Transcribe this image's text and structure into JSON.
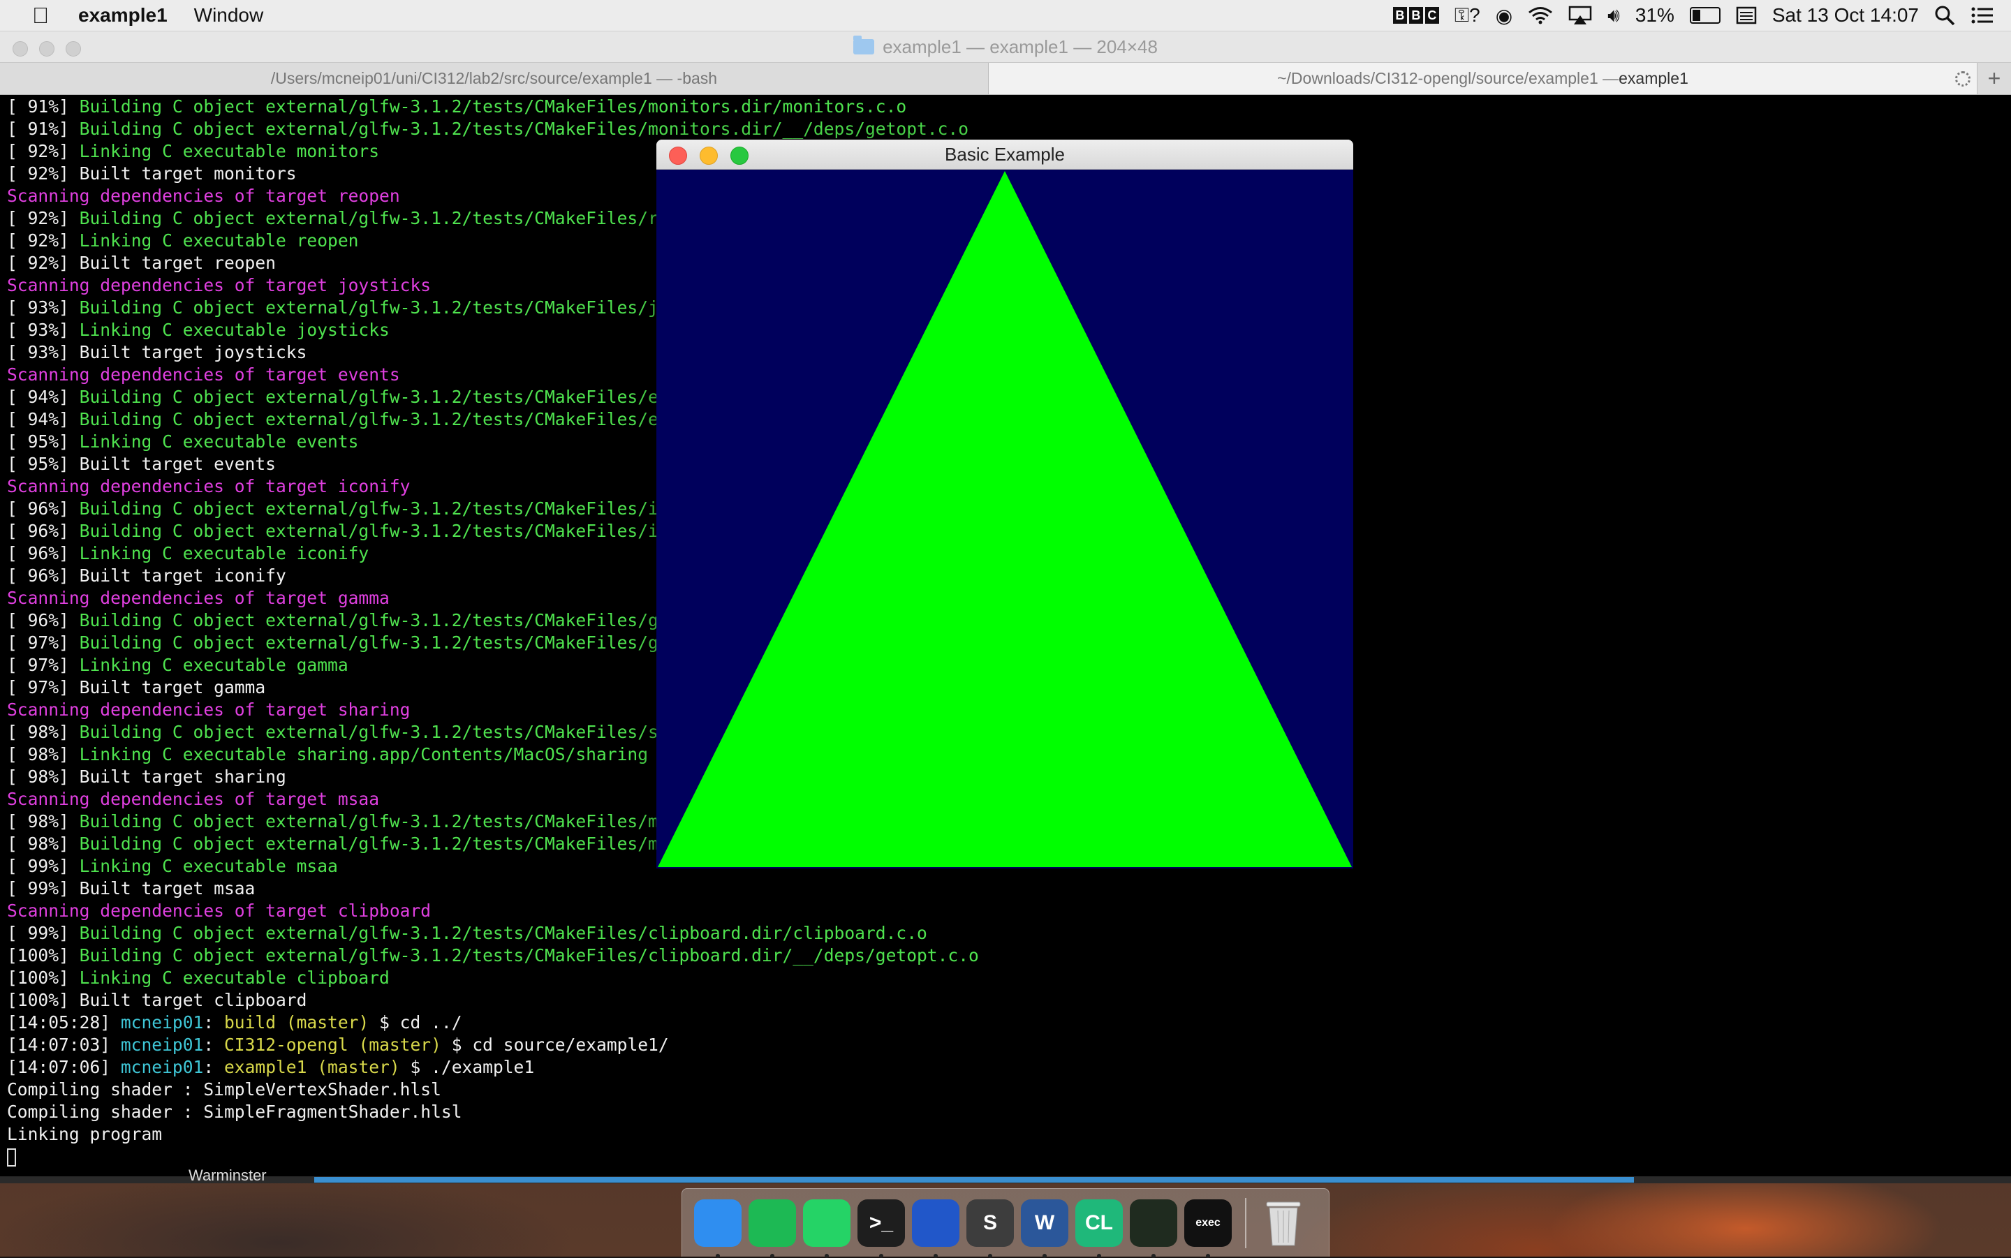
{
  "menubar": {
    "app_name": "example1",
    "menus": [
      "Window"
    ],
    "status": {
      "bbc": [
        "B",
        "B",
        "C"
      ],
      "battery_percent": "31%",
      "battery_level": 0.31,
      "datetime": "Sat 13 Oct  14:07"
    }
  },
  "terminal": {
    "title": "example1 — example1 — 204×48",
    "tabs": [
      {
        "label": "/Users/mcneip01/uni/CI312/lab2/src/source/example1 — -bash",
        "bold": ""
      },
      {
        "label": "~/Downloads/CI312-opengl/source/example1 — ",
        "bold": "example1"
      }
    ],
    "lines": [
      {
        "spans": [
          {
            "t": "[ 91%] ",
            "c": "w"
          },
          {
            "t": "Building C object external/glfw-3.1.2/tests/CMakeFiles/monitors.dir/monitors.c.o",
            "c": "g"
          }
        ]
      },
      {
        "spans": [
          {
            "t": "[ 91%] ",
            "c": "w"
          },
          {
            "t": "Building C object external/glfw-3.1.2/tests/CMakeFiles/monitors.dir/__/deps/getopt.c.o",
            "c": "g"
          }
        ]
      },
      {
        "spans": [
          {
            "t": "[ 92%] ",
            "c": "w"
          },
          {
            "t": "Linking C executable monitors",
            "c": "g"
          }
        ]
      },
      {
        "spans": [
          {
            "t": "[ 92%] Built target monitors",
            "c": "w"
          }
        ]
      },
      {
        "spans": [
          {
            "t": "Scanning dependencies of target reopen",
            "c": "m"
          }
        ]
      },
      {
        "spans": [
          {
            "t": "[ 92%] ",
            "c": "w"
          },
          {
            "t": "Building C object external/glfw-3.1.2/tests/CMakeFiles/reope",
            "c": "g"
          }
        ]
      },
      {
        "spans": [
          {
            "t": "[ 92%] ",
            "c": "w"
          },
          {
            "t": "Linking C executable reopen",
            "c": "g"
          }
        ]
      },
      {
        "spans": [
          {
            "t": "[ 92%] Built target reopen",
            "c": "w"
          }
        ]
      },
      {
        "spans": [
          {
            "t": "Scanning dependencies of target joysticks",
            "c": "m"
          }
        ]
      },
      {
        "spans": [
          {
            "t": "[ 93%] ",
            "c": "w"
          },
          {
            "t": "Building C object external/glfw-3.1.2/tests/CMakeFiles/joyst",
            "c": "g"
          }
        ]
      },
      {
        "spans": [
          {
            "t": "[ 93%] ",
            "c": "w"
          },
          {
            "t": "Linking C executable joysticks",
            "c": "g"
          }
        ]
      },
      {
        "spans": [
          {
            "t": "[ 93%] Built target joysticks",
            "c": "w"
          }
        ]
      },
      {
        "spans": [
          {
            "t": "Scanning dependencies of target events",
            "c": "m"
          }
        ]
      },
      {
        "spans": [
          {
            "t": "[ 94%] ",
            "c": "w"
          },
          {
            "t": "Building C object external/glfw-3.1.2/tests/CMakeFiles/event",
            "c": "g"
          }
        ]
      },
      {
        "spans": [
          {
            "t": "[ 94%] ",
            "c": "w"
          },
          {
            "t": "Building C object external/glfw-3.1.2/tests/CMakeFiles/event",
            "c": "g"
          }
        ]
      },
      {
        "spans": [
          {
            "t": "[ 95%] ",
            "c": "w"
          },
          {
            "t": "Linking C executable events",
            "c": "g"
          }
        ]
      },
      {
        "spans": [
          {
            "t": "[ 95%] Built target events",
            "c": "w"
          }
        ]
      },
      {
        "spans": [
          {
            "t": "Scanning dependencies of target iconify",
            "c": "m"
          }
        ]
      },
      {
        "spans": [
          {
            "t": "[ 96%] ",
            "c": "w"
          },
          {
            "t": "Building C object external/glfw-3.1.2/tests/CMakeFiles/iconi",
            "c": "g"
          }
        ]
      },
      {
        "spans": [
          {
            "t": "[ 96%] ",
            "c": "w"
          },
          {
            "t": "Building C object external/glfw-3.1.2/tests/CMakeFiles/iconi",
            "c": "g"
          }
        ]
      },
      {
        "spans": [
          {
            "t": "[ 96%] ",
            "c": "w"
          },
          {
            "t": "Linking C executable iconify",
            "c": "g"
          }
        ]
      },
      {
        "spans": [
          {
            "t": "[ 96%] Built target iconify",
            "c": "w"
          }
        ]
      },
      {
        "spans": [
          {
            "t": "Scanning dependencies of target gamma",
            "c": "m"
          }
        ]
      },
      {
        "spans": [
          {
            "t": "[ 96%] ",
            "c": "w"
          },
          {
            "t": "Building C object external/glfw-3.1.2/tests/CMakeFiles/gamma",
            "c": "g"
          }
        ]
      },
      {
        "spans": [
          {
            "t": "[ 97%] ",
            "c": "w"
          },
          {
            "t": "Building C object external/glfw-3.1.2/tests/CMakeFiles/gamma",
            "c": "g"
          }
        ]
      },
      {
        "spans": [
          {
            "t": "[ 97%] ",
            "c": "w"
          },
          {
            "t": "Linking C executable gamma",
            "c": "g"
          }
        ]
      },
      {
        "spans": [
          {
            "t": "[ 97%] Built target gamma",
            "c": "w"
          }
        ]
      },
      {
        "spans": [
          {
            "t": "Scanning dependencies of target sharing",
            "c": "m"
          }
        ]
      },
      {
        "spans": [
          {
            "t": "[ 98%] ",
            "c": "w"
          },
          {
            "t": "Building C object external/glfw-3.1.2/tests/CMakeFiles/shari",
            "c": "g"
          }
        ]
      },
      {
        "spans": [
          {
            "t": "[ 98%] ",
            "c": "w"
          },
          {
            "t": "Linking C executable sharing.app/Contents/MacOS/sharing",
            "c": "g"
          }
        ]
      },
      {
        "spans": [
          {
            "t": "[ 98%] Built target sharing",
            "c": "w"
          }
        ]
      },
      {
        "spans": [
          {
            "t": "Scanning dependencies of target msaa",
            "c": "m"
          }
        ]
      },
      {
        "spans": [
          {
            "t": "[ 98%] ",
            "c": "w"
          },
          {
            "t": "Building C object external/glfw-3.1.2/tests/CMakeFiles/msaa.",
            "c": "g"
          }
        ]
      },
      {
        "spans": [
          {
            "t": "[ 98%] ",
            "c": "w"
          },
          {
            "t": "Building C object external/glfw-3.1.2/tests/CMakeFiles/msaa.",
            "c": "g"
          }
        ]
      },
      {
        "spans": [
          {
            "t": "[ 99%] ",
            "c": "w"
          },
          {
            "t": "Linking C executable msaa",
            "c": "g"
          }
        ]
      },
      {
        "spans": [
          {
            "t": "[ 99%] Built target msaa",
            "c": "w"
          }
        ]
      },
      {
        "spans": [
          {
            "t": "Scanning dependencies of target clipboard",
            "c": "m"
          }
        ]
      },
      {
        "spans": [
          {
            "t": "[ 99%] ",
            "c": "w"
          },
          {
            "t": "Building C object external/glfw-3.1.2/tests/CMakeFiles/clipboard.dir/clipboard.c.o",
            "c": "g"
          }
        ]
      },
      {
        "spans": [
          {
            "t": "[100%] ",
            "c": "w"
          },
          {
            "t": "Building C object external/glfw-3.1.2/tests/CMakeFiles/clipboard.dir/__/deps/getopt.c.o",
            "c": "g"
          }
        ]
      },
      {
        "spans": [
          {
            "t": "[100%] ",
            "c": "w"
          },
          {
            "t": "Linking C executable clipboard",
            "c": "g"
          }
        ]
      },
      {
        "spans": [
          {
            "t": "[100%] Built target clipboard",
            "c": "w"
          }
        ]
      },
      {
        "spans": [
          {
            "t": "[14:05:28] ",
            "c": "w"
          },
          {
            "t": "mcneip01",
            "c": "c"
          },
          {
            "t": ": ",
            "c": "w"
          },
          {
            "t": "build (master)",
            "c": "y"
          },
          {
            "t": " $ cd ../",
            "c": "w"
          }
        ]
      },
      {
        "spans": [
          {
            "t": "[14:07:03] ",
            "c": "w"
          },
          {
            "t": "mcneip01",
            "c": "c"
          },
          {
            "t": ": ",
            "c": "w"
          },
          {
            "t": "CI312-opengl (master)",
            "c": "y"
          },
          {
            "t": " $ cd source/example1/",
            "c": "w"
          }
        ]
      },
      {
        "spans": [
          {
            "t": "[14:07:06] ",
            "c": "w"
          },
          {
            "t": "mcneip01",
            "c": "c"
          },
          {
            "t": ": ",
            "c": "w"
          },
          {
            "t": "example1 (master)",
            "c": "y"
          },
          {
            "t": " $ ./example1",
            "c": "w"
          }
        ]
      },
      {
        "spans": [
          {
            "t": "Compiling shader : SimpleVertexShader.hlsl",
            "c": "w"
          }
        ]
      },
      {
        "spans": [
          {
            "t": "Compiling shader : SimpleFragmentShader.hlsl",
            "c": "w"
          }
        ]
      },
      {
        "spans": [
          {
            "t": "Linking program",
            "c": "w"
          }
        ]
      }
    ],
    "background_strip_label": "Warminster"
  },
  "gl_window": {
    "title": "Basic Example",
    "background_color": "#00005c",
    "triangle_color": "#00ff00"
  },
  "dock": {
    "apps": [
      {
        "name": "finder-icon",
        "bg": "#2f8ef0",
        "label": ""
      },
      {
        "name": "spotify-icon",
        "bg": "#1db954",
        "label": ""
      },
      {
        "name": "whatsapp-icon",
        "bg": "#25d366",
        "label": ""
      },
      {
        "name": "terminal-icon",
        "bg": "#1e1e1e",
        "label": ">_"
      },
      {
        "name": "firefox-icon",
        "bg": "#2157c9",
        "label": ""
      },
      {
        "name": "sublime-icon",
        "bg": "#3d3d3d",
        "label": "S"
      },
      {
        "name": "word-icon",
        "bg": "#2b579a",
        "label": "W"
      },
      {
        "name": "clion-icon",
        "bg": "#1fb87a",
        "label": "CL"
      },
      {
        "name": "activity-monitor-icon",
        "bg": "#1f2b1f",
        "label": ""
      },
      {
        "name": "exec-icon",
        "bg": "#111111",
        "label": "exec"
      }
    ],
    "trash": "trash-icon"
  }
}
